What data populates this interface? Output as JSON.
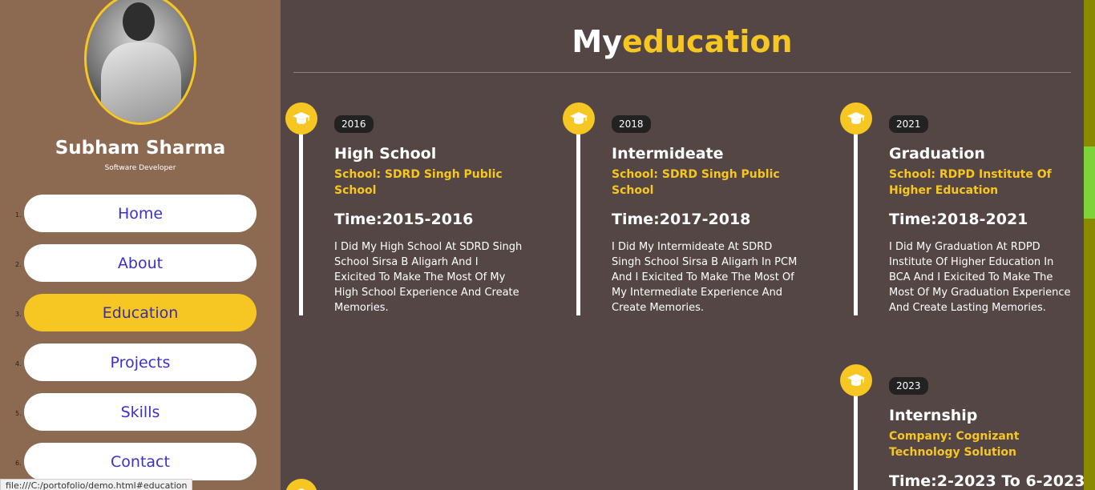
{
  "sidebar": {
    "name": "Subham Sharma",
    "role": "Software Developer",
    "nav": [
      {
        "num": "1.",
        "label": "Home"
      },
      {
        "num": "2.",
        "label": "About"
      },
      {
        "num": "3.",
        "label": "Education"
      },
      {
        "num": "4.",
        "label": "Projects"
      },
      {
        "num": "5.",
        "label": "Skills"
      },
      {
        "num": "6.",
        "label": "Contact"
      }
    ],
    "active": "Education"
  },
  "status_bar": "file:///C:/portofolio/demo.html#education",
  "main": {
    "heading_white": "My",
    "heading_yellow": "education",
    "cards": [
      {
        "year": "2016",
        "title": "High School",
        "school": "School: SDRD Singh Public School",
        "time": "Time:2015-2016",
        "desc": "I Did My High School At SDRD Singh School Sirsa B Aligarh And I Exicited To Make The Most Of My High School Experience And Create Memories."
      },
      {
        "year": "2018",
        "title": "Intermideate",
        "school": "School: SDRD Singh Public School",
        "time": "Time:2017-2018",
        "desc": "I Did My Intermideate At SDRD Singh School Sirsa B Aligarh In PCM And I Exicited To Make The Most Of My Intermediate Experience And Create Memories."
      },
      {
        "year": "2021",
        "title": "Graduation",
        "school": "School: RDPD Institute Of Higher Education",
        "time": "Time:2018-2021",
        "desc": "I Did My Graduation At RDPD Institute Of Higher Education In BCA And I Exicited To Make The Most Of My Graduation Experience And Create Lasting Memories."
      },
      {
        "year": "2023",
        "title": "Internship",
        "school": "Company: Cognizant Technology Solution",
        "time": "Time:2-2023 To 6-2023",
        "desc": ""
      }
    ]
  },
  "colors": {
    "accent": "#f6c623",
    "sidebar_bg": "#8c6a52",
    "main_bg": "#554646",
    "nav_text": "#3a2fd0"
  }
}
